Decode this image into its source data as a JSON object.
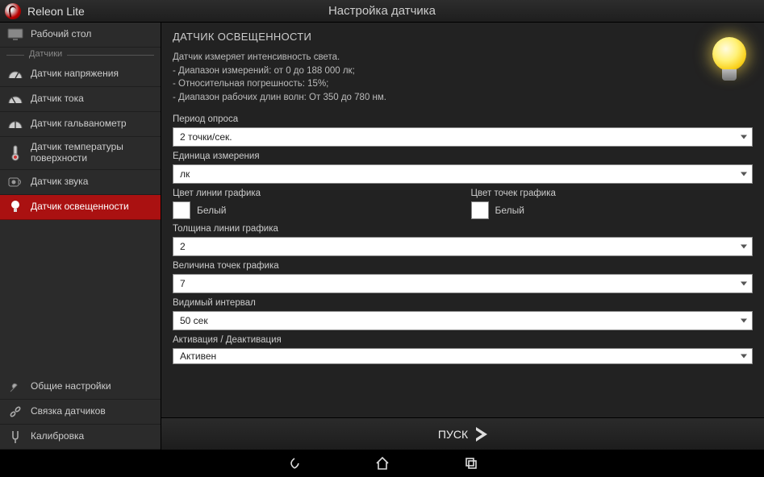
{
  "app": {
    "name": "Releon Lite",
    "title": "Настройка датчика"
  },
  "sidebar": {
    "desktop": "Рабочий стол",
    "section_sensors": "Датчики",
    "items": [
      {
        "label": "Датчик напряжения",
        "icon": "voltage"
      },
      {
        "label": "Датчик тока",
        "icon": "current"
      },
      {
        "label": "Датчик гальванометр",
        "icon": "galvanometer"
      },
      {
        "label": "Датчик температуры поверхности",
        "icon": "thermometer"
      },
      {
        "label": "Датчик звука",
        "icon": "sound"
      },
      {
        "label": "Датчик освещенности",
        "icon": "light",
        "active": true
      }
    ],
    "footer": {
      "settings": "Общие настройки",
      "link": "Связка датчиков",
      "calibration": "Калибровка"
    }
  },
  "main": {
    "heading": "ДАТЧИК ОСВЕЩЕННОСТИ",
    "desc_line1": "Датчик измеряет интенсивность света.",
    "desc_line2": "- Диапазон измерений: от 0 до 188 000 лк;",
    "desc_line3": "- Относительная погрешность: 15%;",
    "desc_line4": "- Диапазон рабочих длин волн: От 350 до 780 нм.",
    "fields": {
      "poll_label": "Период опроса",
      "poll_value": "2 точки/сек.",
      "unit_label": "Единица измерения",
      "unit_value": "лк",
      "line_color_label": "Цвет линии графика",
      "line_color_value": "Белый",
      "point_color_label": "Цвет точек графика",
      "point_color_value": "Белый",
      "line_width_label": "Толщина линии графика",
      "line_width_value": "2",
      "point_size_label": "Величина точек графика",
      "point_size_value": "7",
      "interval_label": "Видимый интервал",
      "interval_value": "50 сек",
      "activation_label": "Активация / Деактивация",
      "activation_value": "Активен"
    },
    "start_button": "ПУСК"
  },
  "colors": {
    "accent": "#a11",
    "swatch_line": "#ffffff",
    "swatch_point": "#ffffff"
  }
}
